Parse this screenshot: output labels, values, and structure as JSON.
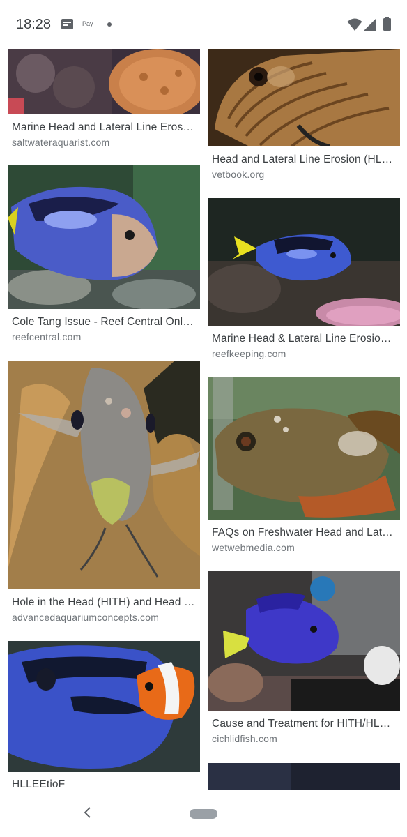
{
  "status_bar": {
    "time": "18:28",
    "pay_label": "Pay",
    "icons": [
      "message-icon",
      "pay-icon",
      "notification-dot",
      "wifi-icon",
      "signal-icon",
      "battery-icon"
    ]
  },
  "results": [
    {
      "title": "Marine Head and Lateral Line Eros…",
      "source": "saltwateraquarist.com",
      "icon": "coral-reef-thumbnail"
    },
    {
      "title": "Head and Lateral Line Erosion (HL…",
      "source": "vetbook.org",
      "icon": "striped-tang-thumbnail"
    },
    {
      "title": "Cole Tang Issue - Reef Central Onli…",
      "source": "reefcentral.com",
      "icon": "blue-tang-thumbnail"
    },
    {
      "title": "Marine Head & Lateral Line Erosio…",
      "source": "reefkeeping.com",
      "icon": "blue-tang-reef-thumbnail"
    },
    {
      "title": "Hole in the Head (HITH) and Head …",
      "source": "advancedaquariumconcepts.com",
      "icon": "angelfish-thumbnail"
    },
    {
      "title": "FAQs on Freshwater Head and Lat…",
      "source": "wetwebmedia.com",
      "icon": "oscar-fish-thumbnail"
    },
    {
      "title": "HLLEEtioF",
      "source": "",
      "icon": "tang-clownfish-thumbnail"
    },
    {
      "title": "Cause and Treatment for HITH/HL…",
      "source": "cichlidfish.com",
      "icon": "purple-tang-thumbnail"
    },
    {
      "title": "",
      "source": "",
      "icon": "partial-thumbnail"
    }
  ],
  "nav": {
    "back_icon": "back-chevron-icon",
    "home_icon": "home-pill-icon"
  },
  "colors": {
    "title_text": "#3c4043",
    "source_text": "#70757a",
    "status_icons": "#5f6368",
    "nav_pill": "#9aa0a6"
  }
}
